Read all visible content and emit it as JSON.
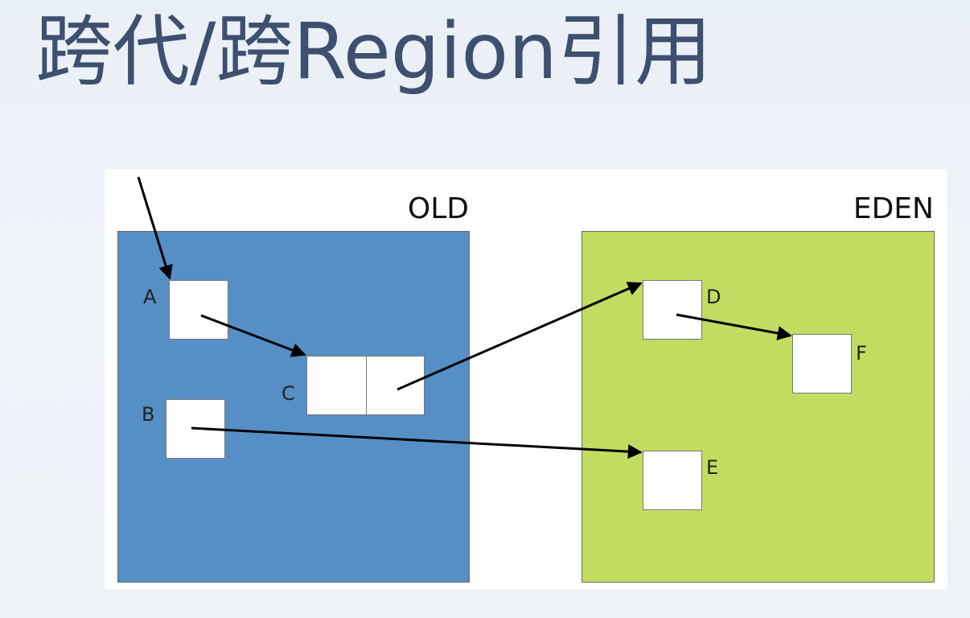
{
  "title": "跨代/跨Region引用",
  "diagram": {
    "regions": [
      {
        "id": "old",
        "label": "OLD",
        "color": "#568fc5"
      },
      {
        "id": "eden",
        "label": "EDEN",
        "color": "#c2dc61"
      }
    ],
    "objects": [
      {
        "id": "A",
        "label": "A",
        "region": "old"
      },
      {
        "id": "B",
        "label": "B",
        "region": "old"
      },
      {
        "id": "C",
        "label": "C",
        "region": "old",
        "cells": 2
      },
      {
        "id": "D",
        "label": "D",
        "region": "eden"
      },
      {
        "id": "E",
        "label": "E",
        "region": "eden"
      },
      {
        "id": "F",
        "label": "F",
        "region": "eden"
      }
    ],
    "references": [
      {
        "from": "root",
        "to": "A"
      },
      {
        "from": "A",
        "to": "C"
      },
      {
        "from": "C",
        "to": "D"
      },
      {
        "from": "D",
        "to": "F"
      },
      {
        "from": "B",
        "to": "E"
      }
    ]
  }
}
